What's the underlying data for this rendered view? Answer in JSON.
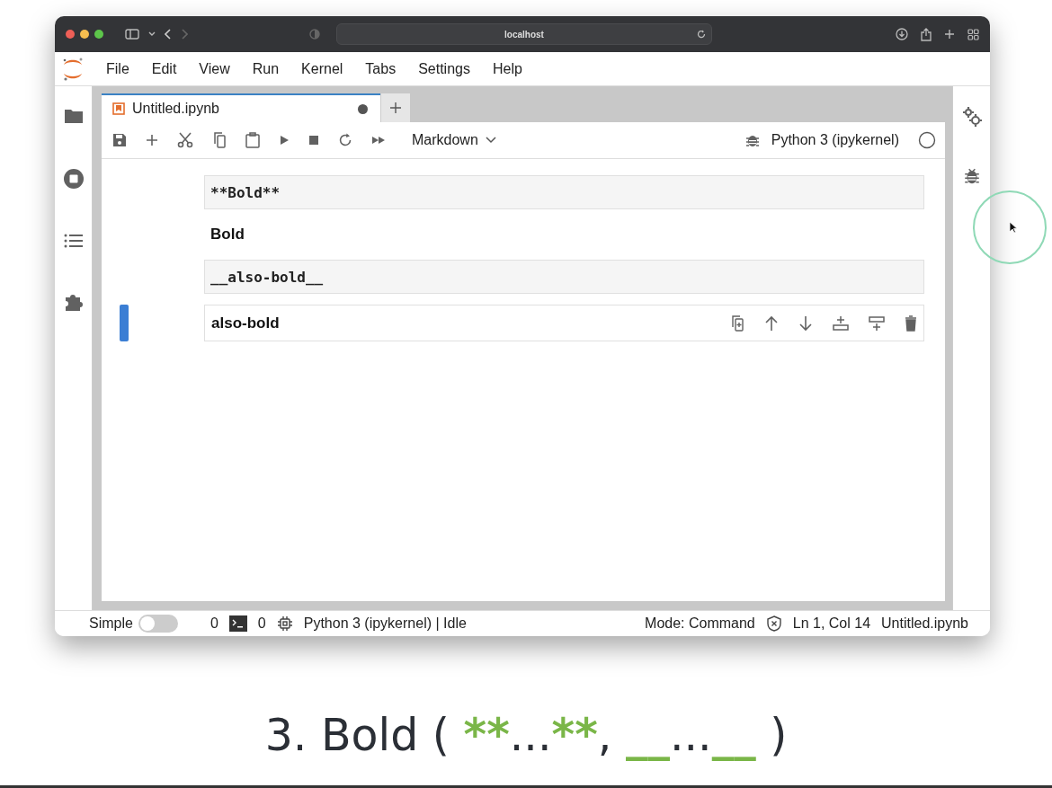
{
  "browser": {
    "address": "localhost"
  },
  "menu": [
    "File",
    "Edit",
    "View",
    "Run",
    "Kernel",
    "Tabs",
    "Settings",
    "Help"
  ],
  "tabs": [
    {
      "label": "Untitled.ipynb",
      "selected": true,
      "modified": true
    }
  ],
  "toolbar": {
    "cell_type": "Markdown",
    "kernel": "Python 3 (ipykernel)"
  },
  "cells": [
    {
      "kind": "source",
      "text": "**Bold**",
      "selected": false
    },
    {
      "kind": "rendered",
      "text": "Bold",
      "selected": false
    },
    {
      "kind": "source",
      "text": "__also-bold__",
      "selected": false
    },
    {
      "kind": "rendered",
      "text": "also-bold",
      "selected": true
    }
  ],
  "status_bar": {
    "simple_mode": {
      "label": "Simple",
      "on": false
    },
    "terminals": "0",
    "kernels": "0",
    "kernel_status": "Python 3 (ipykernel) | Idle",
    "mode": "Mode: Command",
    "position": "Ln 1, Col 14",
    "file": "Untitled.ipynb"
  },
  "caption": [
    {
      "kind": "plain",
      "text": "3. Bold ( "
    },
    {
      "kind": "code",
      "text": "**"
    },
    {
      "kind": "plain",
      "text": "..."
    },
    {
      "kind": "code",
      "text": "**"
    },
    {
      "kind": "plain",
      "text": ", "
    },
    {
      "kind": "code",
      "text": "__"
    },
    {
      "kind": "plain",
      "text": "..."
    },
    {
      "kind": "code",
      "text": "__"
    },
    {
      "kind": "plain",
      "text": " )"
    }
  ]
}
